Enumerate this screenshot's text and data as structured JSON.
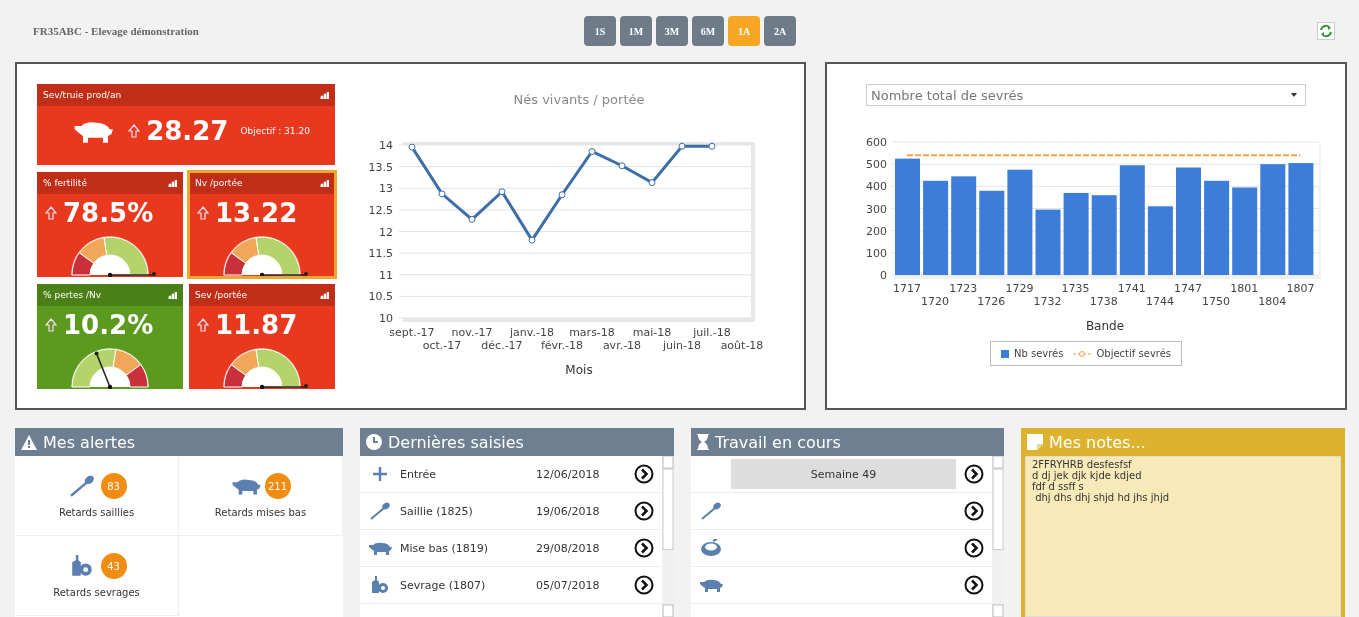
{
  "header": {
    "title": "FR35ABC - Elevage démonstration",
    "periods": [
      {
        "label": "1S",
        "selected": false
      },
      {
        "label": "1M",
        "selected": false
      },
      {
        "label": "3M",
        "selected": false
      },
      {
        "label": "6M",
        "selected": false
      },
      {
        "label": "1A",
        "selected": true
      },
      {
        "label": "2A",
        "selected": false
      }
    ]
  },
  "kpis": [
    {
      "kind": "wide",
      "title": "Sev/truie prod/an",
      "value": "28.27",
      "objective": "Objectif : 31.20",
      "color": "#e8381e",
      "selected": false
    },
    {
      "kind": "gauge",
      "title": "% fertilité",
      "value": "78.5%",
      "color": "#e8381e",
      "selected": false,
      "gauge": {
        "kind": "rising",
        "level": 1
      }
    },
    {
      "kind": "gauge",
      "title": "Nv /portée",
      "value": "13.22",
      "color": "#e8381e",
      "selected": true,
      "gauge": {
        "kind": "rising",
        "level": 1
      }
    },
    {
      "kind": "gauge",
      "title": "% pertes /Nv",
      "value": "10.2%",
      "color": "#5b9a1f",
      "selected": false,
      "gauge": {
        "kind": "falling",
        "level": 0.36
      }
    },
    {
      "kind": "gauge",
      "title": "Sev /portée",
      "value": "11.87",
      "color": "#e8381e",
      "selected": false,
      "gauge": {
        "kind": "rising",
        "level": 1
      }
    }
  ],
  "line_chart": {
    "chart_data": {
      "type": "line",
      "title": "Nés vivants / portée",
      "xlabel": "Mois",
      "categories": [
        "sept.-17",
        "oct.-17",
        "nov.-17",
        "déc.-17",
        "janv.-18",
        "févr.-18",
        "mars-18",
        "avr.-18",
        "mai-18",
        "juin-18",
        "juil.-18",
        "août-18"
      ],
      "values": [
        13.95,
        12.87,
        12.28,
        12.92,
        11.8,
        12.85,
        13.85,
        13.52,
        13.13,
        13.97,
        13.97,
        null
      ],
      "ylim": [
        10,
        14
      ],
      "yticks": [
        10,
        10.5,
        11,
        11.5,
        12,
        12.5,
        13,
        13.5,
        14
      ],
      "grid": true,
      "marker": true
    }
  },
  "bar_panel": {
    "select": {
      "value": "Nombre total de sevrés"
    },
    "chart_data": {
      "type": "bar",
      "xlabel": "Bande",
      "categories": [
        "1717",
        "1720",
        "1723",
        "1726",
        "1729",
        "1732",
        "1735",
        "1738",
        "1741",
        "1744",
        "1747",
        "1750",
        "1801",
        "1804",
        "1807"
      ],
      "series": [
        {
          "name": "Nb sevrés",
          "type": "bar",
          "color": "#3b7dd8",
          "values": [
            525,
            425,
            445,
            380,
            475,
            295,
            370,
            360,
            495,
            310,
            485,
            425,
            395,
            500,
            505
          ]
        },
        {
          "name": "Objectif sevrés",
          "type": "line",
          "line_style": "dashed",
          "color": "#f5a24a",
          "values": [
            540,
            540,
            540,
            540,
            540,
            540,
            540,
            540,
            540,
            540,
            540,
            540,
            540,
            540,
            540
          ]
        }
      ],
      "ylim": [
        0,
        600
      ],
      "yticks": [
        0,
        100,
        200,
        300,
        400,
        500,
        600
      ],
      "grid": true,
      "legend": "bottom"
    }
  },
  "alerts": {
    "title": "Mes alertes",
    "items": [
      {
        "kind": "insemination",
        "count": "83",
        "label": "Retards saillies"
      },
      {
        "kind": "pig",
        "count": "211",
        "label": "Retards mises bas"
      },
      {
        "kind": "bottle",
        "count": "43",
        "label": "Retards sevrages"
      }
    ]
  },
  "entries": {
    "title": "Dernières saisies",
    "rows": [
      {
        "kind": "plus",
        "label": "Entrée",
        "date": "12/06/2018"
      },
      {
        "kind": "insemination",
        "label": "Saillie (1825)",
        "date": "19/06/2018"
      },
      {
        "kind": "pig",
        "label": "Mise bas (1819)",
        "date": "29/08/2018"
      },
      {
        "kind": "bottle",
        "label": "Sevrage (1807)",
        "date": "05/07/2018"
      }
    ]
  },
  "work": {
    "title": "Travail en cours",
    "rows": [
      {
        "kind": "week",
        "label": "Semaine 49"
      },
      {
        "kind": "insemination"
      },
      {
        "kind": "bowl"
      },
      {
        "kind": "pig"
      }
    ]
  },
  "notes": {
    "title": "Mes notes...",
    "lines": [
      "2FFRYHRB desfesfsf",
      "d dj jek djk kjde kdjed",
      "fdf d ssff s",
      " dhj dhs dhj shjd hd jhs jhjd"
    ]
  }
}
